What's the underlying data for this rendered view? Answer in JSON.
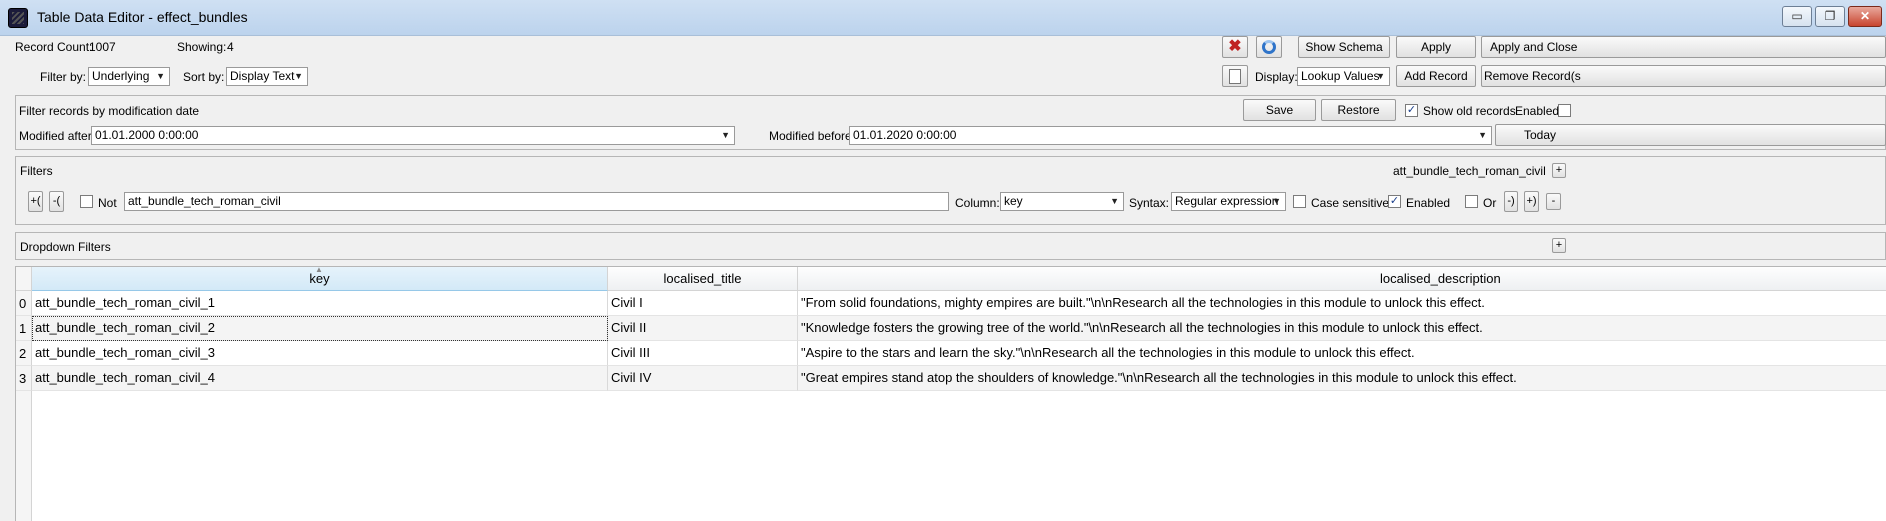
{
  "window": {
    "title": "Table Data Editor - effect_bundles",
    "minimize_label": "▭",
    "maximize_label": "❐",
    "close_label": "✕"
  },
  "top": {
    "record_count_label": "Record Count:",
    "record_count": "1007",
    "showing_label": "Showing:",
    "showing": "4",
    "filter_by_label": "Filter by:",
    "filter_by_value": "Underlying",
    "sort_by_label": "Sort by:",
    "sort_by_value": "Display Text",
    "display_label": "Display:",
    "display_value": "Lookup Values",
    "show_schema": "Show Schema",
    "apply": "Apply",
    "apply_and_close": "Apply and Close",
    "add_record": "Add Record",
    "remove_record": "Remove Record(s"
  },
  "modification": {
    "title": "Filter records by modification date",
    "save": "Save",
    "restore": "Restore",
    "show_old_records": "Show old records",
    "show_old_checked": "✓",
    "enabled": "Enabled",
    "modified_after_label": "Modified after:",
    "modified_after_value": "01.01.2000 0:00:00",
    "modified_before_label": "Modified before:",
    "modified_before_value": "01.01.2020 0:00:00",
    "today": "Today"
  },
  "filters": {
    "title": "Filters",
    "current_filter": "att_bundle_tech_roman_civil",
    "add_group_open": "+(",
    "add_group_close": "-(",
    "not_label": "Not",
    "filter_value": "att_bundle_tech_roman_civil",
    "column_label": "Column:",
    "column_value": "key",
    "syntax_label": "Syntax:",
    "syntax_value": "Regular expression",
    "case_sensitive": "Case sensitive",
    "enabled": "Enabled",
    "enabled_checked": "✓",
    "or_label": "Or",
    "close_paren": "-)",
    "add_paren": "+)",
    "remove": "-",
    "add": "+"
  },
  "dropdown_filters": {
    "title": "Dropdown Filters",
    "add": "+"
  },
  "table": {
    "columns": [
      "key",
      "localised_title",
      "localised_description"
    ],
    "rows": [
      {
        "num": "0",
        "key": "att_bundle_tech_roman_civil_1",
        "title": "Civil I",
        "desc": "\"From solid foundations, mighty empires are built.\"\\n\\nResearch all the technologies in this module to unlock this effect."
      },
      {
        "num": "1",
        "key": "att_bundle_tech_roman_civil_2",
        "title": "Civil II",
        "desc": "\"Knowledge fosters the growing tree of the world.\"\\n\\nResearch all the technologies in this module to unlock this effect."
      },
      {
        "num": "2",
        "key": "att_bundle_tech_roman_civil_3",
        "title": "Civil III",
        "desc": "\"Aspire to the stars and learn the sky.\"\\n\\nResearch all the technologies in this module to unlock this effect."
      },
      {
        "num": "3",
        "key": "att_bundle_tech_roman_civil_4",
        "title": "Civil IV",
        "desc": "\"Great empires stand atop the shoulders of knowledge.\"\\n\\nResearch all the technologies in this module to unlock this effect."
      }
    ]
  }
}
